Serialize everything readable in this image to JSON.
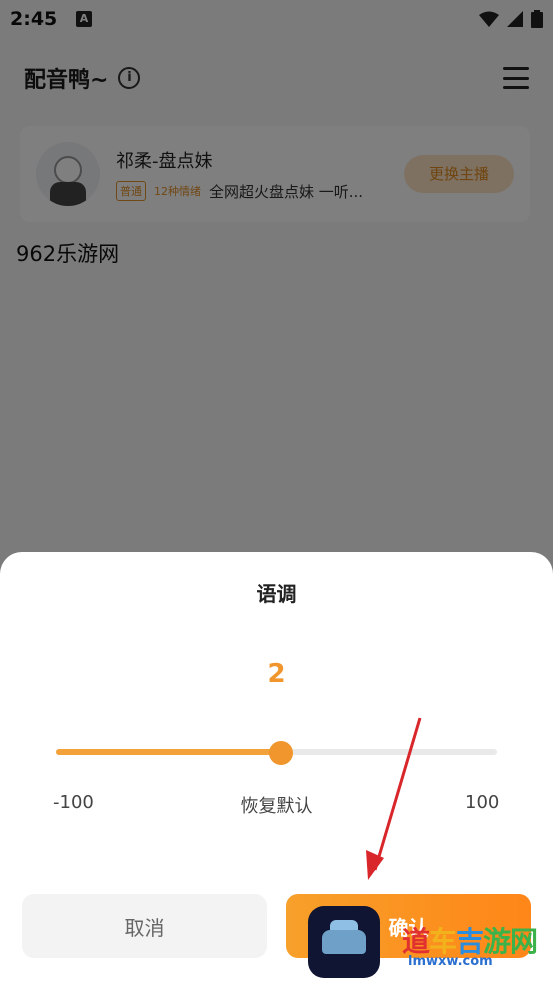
{
  "status": {
    "time": "2:45"
  },
  "app": {
    "title": "配音鸭~"
  },
  "anchor": {
    "name": "祁柔-盘点妹",
    "tag_level": "普通",
    "tag_emotion": "12种情绪",
    "description": "全网超火盘点妹 一听...",
    "change_button": "更换主播"
  },
  "content": {
    "text": "962乐游网"
  },
  "sheet": {
    "title": "语调",
    "value": "2",
    "slider": {
      "min": -100,
      "max": 100,
      "value": 2
    },
    "min_label": "-100",
    "max_label": "100",
    "reset_label": "恢复默认",
    "cancel_label": "取消",
    "confirm_label": "确认"
  },
  "watermark": {
    "text_1": "道",
    "text_2": "车",
    "text_3": "吉",
    "text_4": "游网",
    "url": "lmwxw.com"
  },
  "colors": {
    "accent": "#f0962c",
    "dim": "#000000"
  }
}
